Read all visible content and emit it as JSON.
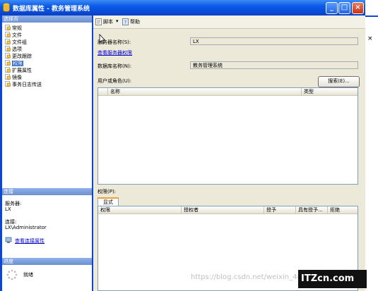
{
  "window": {
    "title": "数据库属性 - 教务管理系统"
  },
  "left_panel": {
    "select_page_header": "选择页",
    "pages": [
      "常规",
      "文件",
      "文件组",
      "选项",
      "更改跟踪",
      "权限",
      "扩展属性",
      "镜像",
      "事务日志传送"
    ],
    "selected_index": 5,
    "connection_header": "连接",
    "server_label": "服务器:",
    "server_value": "LX",
    "connection_label": "连接:",
    "connection_value": "LX\\Administrator",
    "view_connection_link": "查看连接属性",
    "progress_header": "进度",
    "progress_status": "就绪"
  },
  "toolbar": {
    "script_label": "脚本",
    "help_label": "帮助"
  },
  "form": {
    "server_name_label": "服务器名称(S):",
    "server_name_value": "LX",
    "view_server_permissions_link": "查看服务器权限",
    "db_name_label": "数据库名称(N):",
    "db_name_value": "教务管理系统",
    "users_roles_label": "用户或角色(U):",
    "search_button": "搜索(E)...",
    "users_grid_columns": [
      "名称",
      "类型"
    ],
    "permissions_label": "权限(P):",
    "tab_explicit": "显式",
    "perm_grid_columns": [
      "权限",
      "授权者",
      "授予",
      "具有授予...",
      "拒绝"
    ]
  },
  "overlay": {
    "watermark": "https://blog.csdn.net/weixin_44090047",
    "logo_text": "ITZcn.com"
  },
  "colors": {
    "title_blue": "#0a46d8",
    "selection": "#316ac5",
    "link": "#0000cc"
  }
}
